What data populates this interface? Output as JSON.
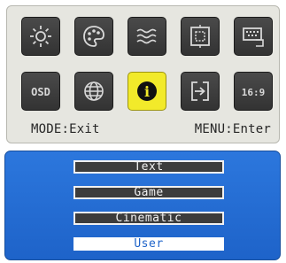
{
  "menu": {
    "icons": [
      {
        "name": "brightness-icon",
        "label": ""
      },
      {
        "name": "color-palette-icon",
        "label": ""
      },
      {
        "name": "noise-waves-icon",
        "label": ""
      },
      {
        "name": "image-position-icon",
        "label": ""
      },
      {
        "name": "input-source-icon",
        "label": ""
      },
      {
        "name": "osd-settings-icon",
        "label": "OSD"
      },
      {
        "name": "language-globe-icon",
        "label": ""
      },
      {
        "name": "information-icon",
        "label": "i"
      },
      {
        "name": "input-select-icon",
        "label": ""
      },
      {
        "name": "aspect-ratio-icon",
        "label": "16:9"
      }
    ],
    "selected_index": 7,
    "hint_left": "MODE:Exit",
    "hint_right": "MENU:Enter"
  },
  "modes": {
    "items": [
      "Text",
      "Game",
      "Cinematic",
      "User"
    ],
    "active": "User"
  },
  "colors": {
    "tile": "#3a3a3a",
    "selected_tile": "#f2ea2a",
    "panel_top": "#e6e6e0",
    "panel_bottom": "#2066cc",
    "mode_item": "#3c3c3c",
    "mode_active": "#ffffff"
  }
}
